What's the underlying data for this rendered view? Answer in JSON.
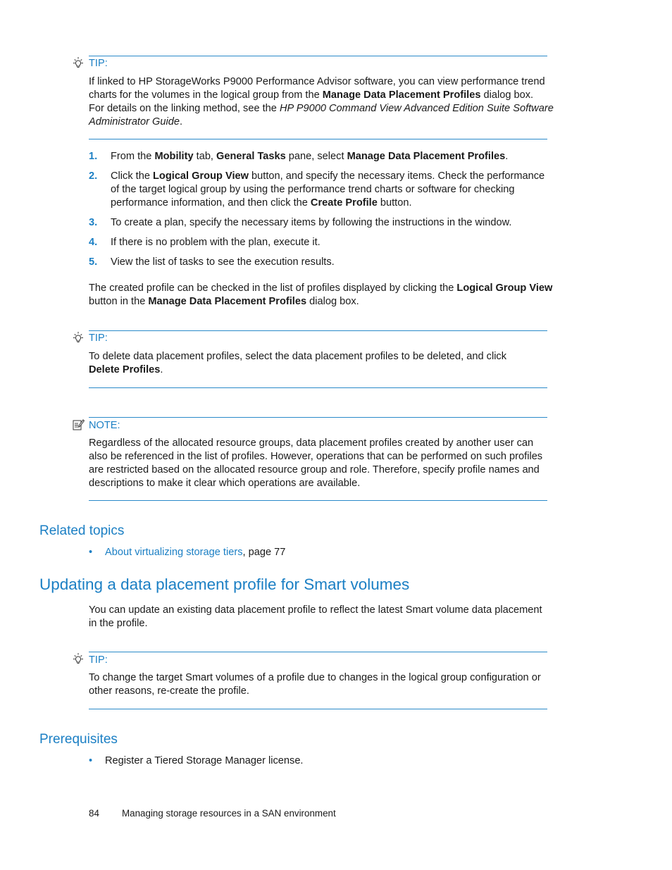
{
  "tip1": {
    "label": "TIP:",
    "icon": "lightbulb-icon",
    "line1": "If linked to HP StorageWorks P9000 Performance Advisor software, you can view performance trend",
    "line2_pre": "charts for the volumes in the logical group from the ",
    "line2_bold": "Manage Data Placement Profiles",
    "line2_post": " dialog box.",
    "line3_pre": "For details on the linking method, see the ",
    "line3_italic": "HP P9000 Command View Advanced Edition Suite Software",
    "line4_italic": "Administrator Guide",
    "line4_post": "."
  },
  "steps": [
    {
      "num": "1.",
      "parts": [
        {
          "t": "From the "
        },
        {
          "b": "Mobility"
        },
        {
          "t": " tab, "
        },
        {
          "b": "General Tasks"
        },
        {
          "t": " pane, select "
        },
        {
          "b": "Manage Data Placement Profiles"
        },
        {
          "t": "."
        }
      ]
    },
    {
      "num": "2.",
      "line1_pre": "Click the ",
      "line1_bold": "Logical Group View",
      "line1_post": " button, and specify the necessary items. Check the performance",
      "line2": "of the target logical group by using the performance trend charts or software for checking",
      "line3_pre": "performance information, and then click the ",
      "line3_bold": "Create Profile",
      "line3_post": " button."
    },
    {
      "num": "3.",
      "text": "To create a plan, specify the necessary items by following the instructions in the window."
    },
    {
      "num": "4.",
      "text": "If there is no problem with the plan, execute it."
    },
    {
      "num": "5.",
      "text": "View the list of tasks to see the execution results."
    }
  ],
  "created_para": {
    "line1_pre": "The created profile can be checked in the list of profiles displayed by clicking the ",
    "line1_bold": "Logical Group View",
    "line2_pre": "button in the ",
    "line2_bold": "Manage Data Placement Profiles",
    "line2_post": " dialog box."
  },
  "tip2": {
    "label": "TIP:",
    "icon": "lightbulb-icon",
    "line1": "To delete data placement profiles, select the data placement profiles to be deleted, and click",
    "line2_bold": "Delete Profiles",
    "line2_post": "."
  },
  "note": {
    "label": "NOTE:",
    "icon": "note-pencil-icon",
    "lines": [
      "Regardless of the allocated resource groups, data placement profiles created by another user can",
      "also be referenced in the list of profiles. However, operations that can be performed on such profiles",
      "are restricted based on the allocated resource group and role. Therefore, specify profile names and",
      "descriptions to make it clear which operations are available."
    ]
  },
  "related_topics": {
    "heading": "Related topics",
    "items": [
      {
        "bullet": "•",
        "link": "About virtualizing storage tiers",
        "suffix": ", page 77"
      }
    ]
  },
  "section": {
    "title": "Updating a data placement profile for Smart volumes",
    "intro_lines": [
      "You can update an existing data placement profile to reflect the latest Smart volume data placement",
      "in the profile."
    ]
  },
  "tip3": {
    "label": "TIP:",
    "icon": "lightbulb-icon",
    "lines": [
      "To change the target Smart volumes of a profile due to changes in the logical group configuration or",
      "other reasons, re-create the profile."
    ]
  },
  "prerequisites": {
    "heading": "Prerequisites",
    "items": [
      {
        "bullet": "•",
        "text": "Register a Tiered Storage Manager license."
      }
    ]
  },
  "footer": {
    "page_number": "84",
    "title": "Managing storage resources in a SAN environment"
  },
  "colors": {
    "accent": "#1b7fc4",
    "rule": "#2a8ac9",
    "text": "#1a1a1a"
  }
}
